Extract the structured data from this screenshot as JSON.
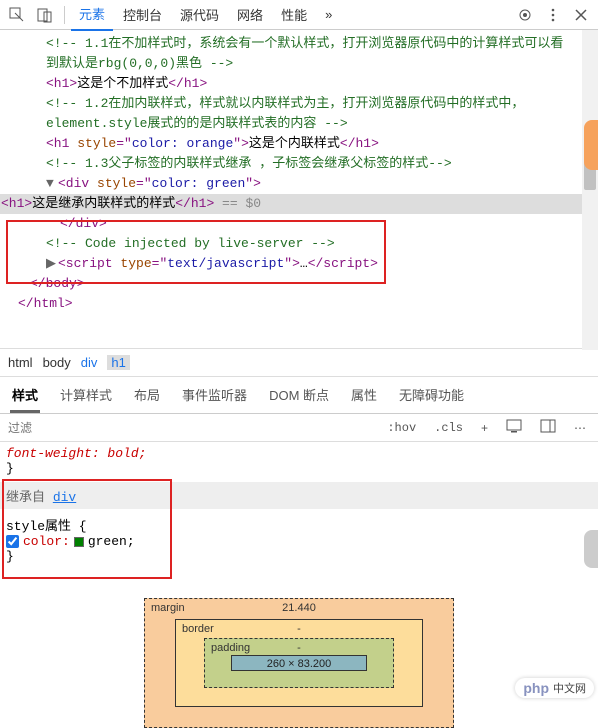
{
  "toolbar": {
    "tabs": [
      "元素",
      "控制台",
      "源代码",
      "网络",
      "性能"
    ],
    "more": "»"
  },
  "elements": {
    "comment1": "<!-- 1.1在不加样式时，系统会有一个默认样式，打开浏览器原代码中的计算样式可以看到默认是rbg(0,0,0)黑色 -->",
    "h1a_open": "<h1>",
    "h1a_text": "这是个不加样式",
    "h1a_close": "</h1>",
    "comment2": "<!-- 1.2在加内联样式，样式就以内联样式为主，打开浏览器原代码中的样式中，element.style展式的的是内联样式表的内容 -->",
    "h1b_open": "<h1 ",
    "h1b_attr": "style",
    "h1b_eq": "=\"",
    "h1b_val": "color: orange",
    "h1b_end": "\">",
    "h1b_text": "这是个内联样式",
    "h1b_close": "</h1>",
    "comment3": "<!-- 1.3父子标签的内联样式继承 ，子标签会继承父标签的样式-->",
    "div_open": "<div ",
    "div_attr": "style",
    "div_eq": "=\"",
    "div_val": "color: green",
    "div_end": "\">",
    "h1c_open": "<h1>",
    "h1c_text": "这是继承内联样式的样式",
    "h1c_close": "</h1>",
    "sel_hint": " == $0",
    "div_close": "</div>",
    "comment4": "<!-- Code injected by live-server -->",
    "script_open": "<script ",
    "script_attr": "type",
    "script_eq": "=\"",
    "script_val": "text/javascript",
    "script_end": "\">",
    "script_ell": "…",
    "script_close": "</script>",
    "body_close": "</body>",
    "html_close": "</html>"
  },
  "breadcrumb": [
    "html",
    "body",
    "div",
    "h1"
  ],
  "styles_tabs": [
    "样式",
    "计算样式",
    "布局",
    "事件监听器",
    "DOM 断点",
    "属性",
    "无障碍功能"
  ],
  "filter": {
    "placeholder": "过滤",
    "hov": ":hov",
    "cls": ".cls",
    "plus": "+"
  },
  "styles_body": {
    "existing_rule": "font-weight: bold;",
    "brace": "}",
    "inherit_prefix": "继承自 ",
    "inherit_tag": "div",
    "style_attr_label": "style属性 {",
    "prop_name": "color",
    "prop_val": "green;",
    "close_brace": "}"
  },
  "box_model": {
    "margin_label": "margin",
    "margin_top": "21.440",
    "border_label": "border",
    "border_top": "-",
    "padding_label": "padding",
    "padding_top": "-",
    "content": "260 × 83.200"
  },
  "logo": {
    "php": "php",
    "text": "中文网"
  }
}
